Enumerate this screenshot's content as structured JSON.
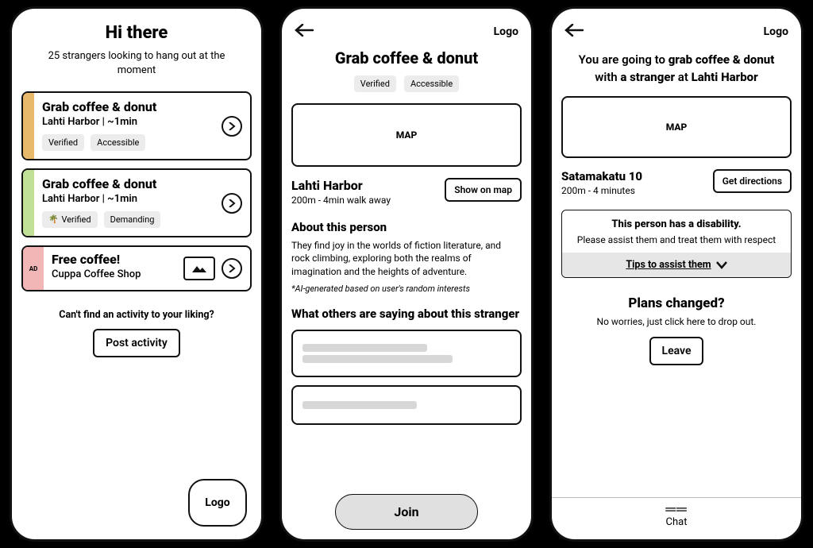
{
  "logo_label": "Logo",
  "screen1": {
    "greeting": "Hi there",
    "subtitle": "25 strangers looking to hang out at the moment",
    "cards": [
      {
        "title": "Grab coffee & donut",
        "location_line": "Lahti Harbor | ~1min",
        "tags": [
          "Verified",
          "Accessible"
        ],
        "stripe": "orange"
      },
      {
        "title": "Grab coffee & donut",
        "location_line": "Lahti Harbor | ~1min",
        "tags": [
          "Verified",
          "Demanding"
        ],
        "has_palm_icon": true,
        "stripe": "green"
      },
      {
        "ad_label": "AD",
        "title": "Free coffee!",
        "subtitle": "Cuppa Coffee Shop",
        "stripe": "pink",
        "has_image_thumb": true
      }
    ],
    "prompt_text": "Can't find an activity to your liking?",
    "post_button": "Post activity",
    "logo_chip": "Logo"
  },
  "screen2": {
    "title": "Grab coffee & donut",
    "tags": [
      "Verified",
      "Accessible"
    ],
    "map_label": "MAP",
    "location": {
      "name": "Lahti Harbor",
      "distance_line": "200m - 4min walk away",
      "show_on_map": "Show on map"
    },
    "about_heading": "About this person",
    "about_body": "They find joy in the worlds of fiction literature, and rock climbing, exploring both the realms of imagination and the heights of adventure.",
    "about_note": "*AI-generated based on user's random interests",
    "others_heading": "What others are saying about this stranger",
    "join_button": "Join"
  },
  "screen3": {
    "headline_pre": "You are going to ",
    "headline_act": "grab coffee & donut",
    "headline_mid": " with ",
    "headline_who": "a stranger",
    "headline_at": " at ",
    "headline_place": "Lahti Harbor",
    "map_label": "MAP",
    "address": "Satamakatu 10",
    "address_sub": "200m - 4 minutes",
    "directions_button": "Get directions",
    "disability": {
      "title": "This person has a disability.",
      "body": "Please assist them and treat them with respect",
      "expand": "Tips to assist them"
    },
    "plans_heading": "Plans changed?",
    "plans_sub": "No worries, just click here to drop out.",
    "leave_button": "Leave",
    "chat_label": "Chat"
  }
}
